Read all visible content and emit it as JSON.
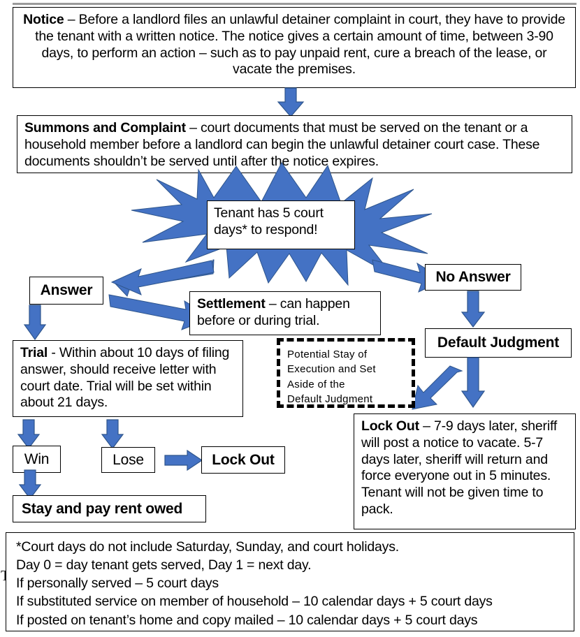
{
  "theme": {
    "arrow_fill": "#4472C4",
    "arrow_stroke": "#2E558C",
    "box_border": "#000000",
    "page_background": "#FFFFFF",
    "rule_color": "#9A9A9A"
  },
  "diagram": {
    "title_rule": "",
    "notice": {
      "lead": "Notice",
      "body": " – Before a landlord files an unlawful detainer complaint in court, they have to provide the tenant with a written notice. The notice gives a certain amount of time, between 3-90 days, to perform an action – such as to pay unpaid rent, cure a breach of the lease, or vacate the premises."
    },
    "summons": {
      "lead": "Summons and Complaint",
      "body": " – court documents that must be served on the tenant or a household member before a landlord can begin the unlawful detainer court case. These documents shouldn’t be served until after the notice expires."
    },
    "burst": {
      "text": "Tenant has 5 court days* to respond!"
    },
    "answer": {
      "label": "Answer"
    },
    "settlement": {
      "lead": "Settlement",
      "body": " – can happen before or during trial."
    },
    "no_answer": {
      "label": "No Answer"
    },
    "default_judgment": {
      "label": "Default Judgment"
    },
    "trial": {
      "lead": "Trial",
      "body": " - Within about 10 days of filing answer, should receive letter with court date. Trial will be set within about 21 days."
    },
    "stay": {
      "lines": [
        "Potential Stay of",
        "Execution and Set",
        "Aside of the",
        "Default Judgment"
      ]
    },
    "lockout_detail": {
      "lead": "Lock Out",
      "body": " – 7-9 days later, sheriff will post a notice to vacate. 5-7 days later, sheriff will return and force everyone out in 5 minutes. Tenant will not be given time to pack."
    },
    "win": {
      "label": "Win"
    },
    "lose": {
      "label": "Lose"
    },
    "lockout": {
      "label": "Lock Out"
    },
    "stay_and_pay": {
      "label": "Stay and pay rent owed"
    },
    "footnote": {
      "lines": [
        "*Court days do not include Saturday, Sunday, and court holidays.",
        "Day 0 = day tenant gets served, Day 1 = next day.",
        "If personally served – 5 court days",
        "If substituted service on member of household – 10 calendar days + 5 court days",
        "If posted on tenant’s home and copy mailed – 10 calendar days + 5 court days"
      ]
    },
    "stray_char": "T"
  }
}
